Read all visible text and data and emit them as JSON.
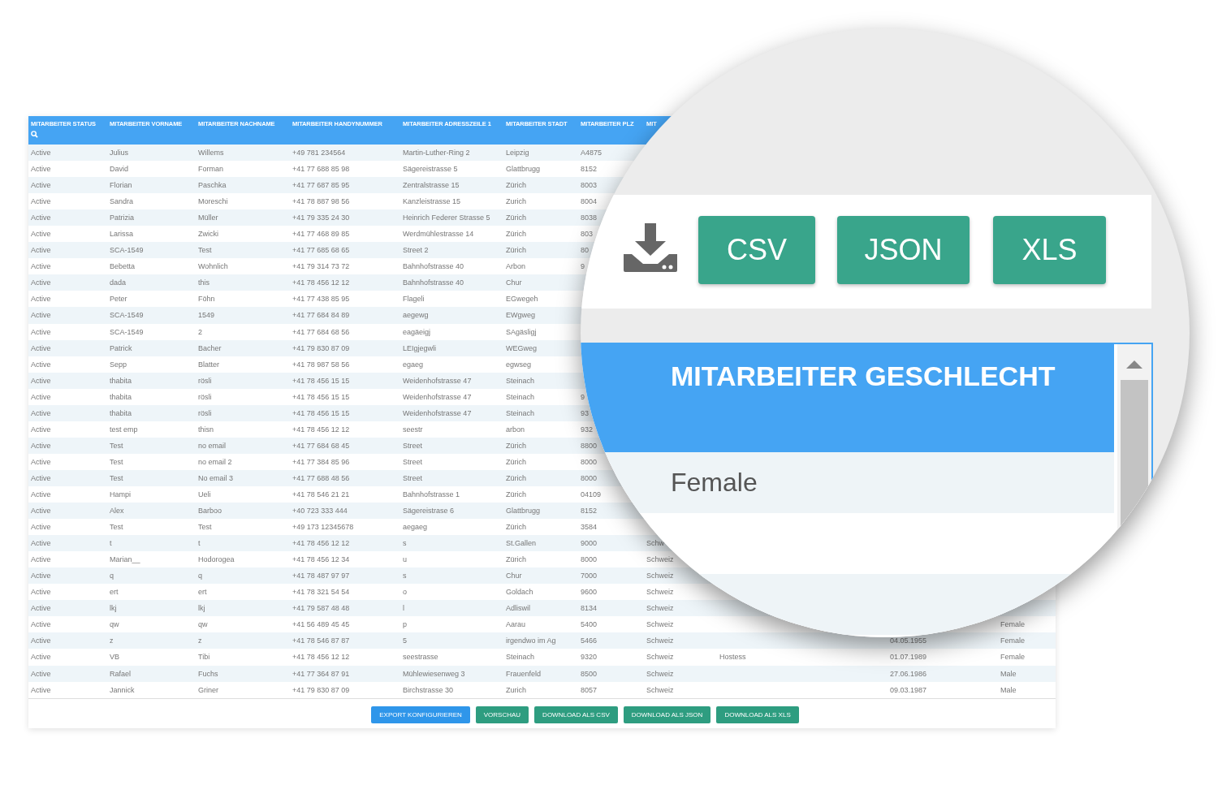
{
  "table": {
    "columns": [
      "MITARBEITER STATUS",
      "MITARBEITER VORNAME",
      "MITARBEITER NACHNAME",
      "MITARBEITER HANDYNUMMER",
      "MITARBEITER ADRESSZEILE 1",
      "MITARBEITER STADT",
      "MITARBEITER PLZ",
      "MIT",
      null,
      null,
      null
    ],
    "rows": [
      [
        "Active",
        "Julius",
        "Willems",
        "+49 781 234564",
        "Martin-Luther-Ring 2",
        "Leipzig",
        "A4875",
        null,
        null,
        null,
        null
      ],
      [
        "Active",
        "David",
        "Forman",
        "+41 77 688 85 98",
        "Sägereistrasse 5",
        "Glattbrugg",
        "8152",
        null,
        null,
        null,
        null
      ],
      [
        "Active",
        "Florian",
        "Paschka",
        "+41 77 687 85 95",
        "Zentralstrasse 15",
        "Zürich",
        "8003",
        null,
        null,
        null,
        null
      ],
      [
        "Active",
        "Sandra",
        "Moreschi",
        "+41 78 887 98 56",
        "Kanzleistrasse 15",
        "Zurich",
        "8004",
        null,
        null,
        null,
        null
      ],
      [
        "Active",
        "Patrizia",
        "Müller",
        "+41 79 335 24 30",
        "Heinrich Federer Strasse 5",
        "Zürich",
        "8038",
        null,
        null,
        null,
        null
      ],
      [
        "Active",
        "Larissa",
        "Zwicki",
        "+41 77 468 89 85",
        "Werdmühlestrasse 14",
        "Zürich",
        "803",
        null,
        null,
        null,
        null
      ],
      [
        "Active",
        "SCA-1549",
        "Test",
        "+41 77 685 68 65",
        "Street 2",
        "Zürich",
        "80",
        null,
        null,
        null,
        null
      ],
      [
        "Active",
        "Bebetta",
        "Wohnlich",
        "+41 79 314 73 72",
        "Bahnhofstrasse 40",
        "Arbon",
        "9",
        null,
        null,
        null,
        null
      ],
      [
        "Active",
        "dada",
        "this",
        "+41 78 456 12 12",
        "Bahnhofstrasse 40",
        "Chur",
        null,
        null,
        null,
        null,
        null
      ],
      [
        "Active",
        "Peter",
        "Föhn",
        "+41 77 438 85 95",
        "Flageli",
        "EGwegeh",
        null,
        null,
        null,
        null,
        null
      ],
      [
        "Active",
        "SCA-1549",
        "1549",
        "+41 77 684 84 89",
        "aegewg",
        "EWgweg",
        null,
        null,
        null,
        null,
        null
      ],
      [
        "Active",
        "SCA-1549",
        "2",
        "+41 77 684 68 56",
        "eagäeigj",
        "SAgäsligj",
        null,
        null,
        null,
        null,
        null
      ],
      [
        "Active",
        "Patrick",
        "Bacher",
        "+41 79 830 87 09",
        "LEIgjegwli",
        "WEGweg",
        null,
        null,
        null,
        null,
        null
      ],
      [
        "Active",
        "Sepp",
        "Blatter",
        "+41 78 987 58 56",
        "egaeg",
        "egwseg",
        null,
        null,
        null,
        null,
        null
      ],
      [
        "Active",
        "thabita",
        "rösli",
        "+41 78 456 15 15",
        "Weidenhofstrasse 47",
        "Steinach",
        null,
        null,
        null,
        null,
        null
      ],
      [
        "Active",
        "thabita",
        "rösli",
        "+41 78 456 15 15",
        "Weidenhofstrasse 47",
        "Steinach",
        "9",
        null,
        null,
        null,
        null
      ],
      [
        "Active",
        "thabita",
        "rösli",
        "+41 78 456 15 15",
        "Weidenhofstrasse 47",
        "Steinach",
        "93",
        null,
        null,
        null,
        null
      ],
      [
        "Active",
        "test emp",
        "thisn",
        "+41 78 456 12 12",
        "seestr",
        "arbon",
        "932",
        null,
        null,
        null,
        null
      ],
      [
        "Active",
        "Test",
        "no email",
        "+41 77 684 68 45",
        "Street",
        "Zürich",
        "8800",
        null,
        null,
        null,
        null
      ],
      [
        "Active",
        "Test",
        "no email 2",
        "+41 77 384 85 96",
        "Street",
        "Zürich",
        "8000",
        null,
        null,
        null,
        null
      ],
      [
        "Active",
        "Test",
        "No email 3",
        "+41 77 688 48 56",
        "Street",
        "Zürich",
        "8000",
        null,
        null,
        null,
        null
      ],
      [
        "Active",
        "Hampi",
        "Ueli",
        "+41 78 546 21 21",
        "Bahnhofstrasse 1",
        "Zürich",
        "04109",
        null,
        null,
        null,
        null
      ],
      [
        "Active",
        "Alex",
        "Barboo",
        "+40 723 333 444",
        "Sägereistrase 6",
        "Glattbrugg",
        "8152",
        null,
        null,
        null,
        null
      ],
      [
        "Active",
        "Test",
        "Test",
        "+49 173 12345678",
        "aegaeg",
        "Zürich",
        "3584",
        null,
        null,
        null,
        null
      ],
      [
        "Active",
        "t",
        "t",
        "+41 78 456 12 12",
        "s",
        "St.Gallen",
        "9000",
        "Schw",
        null,
        null,
        null
      ],
      [
        "Active",
        "Marian__",
        "Hodorogea",
        "+41 78 456 12 34",
        "u",
        "Zürich",
        "8000",
        "Schweiz",
        null,
        null,
        null
      ],
      [
        "Active",
        "q",
        "q",
        "+41 78 487 97 97",
        "s",
        "Chur",
        "7000",
        "Schweiz",
        null,
        null,
        null
      ],
      [
        "Active",
        "ert",
        "ert",
        "+41 78 321 54 54",
        "o",
        "Goldach",
        "9600",
        "Schweiz",
        null,
        null,
        null
      ],
      [
        "Active",
        "lkj",
        "lkj",
        "+41 79 587 48 48",
        "l",
        "Adliswil",
        "8134",
        "Schweiz",
        null,
        null,
        null
      ],
      [
        "Active",
        "qw",
        "qw",
        "+41 56 489 45 45",
        "p",
        "Aarau",
        "5400",
        "Schweiz",
        null,
        null,
        "Female"
      ],
      [
        "Active",
        "z",
        "z",
        "+41 78 546 87 87",
        "5",
        "irgendwo im Ag",
        "5466",
        "Schweiz",
        null,
        "04.05.1955",
        "Female"
      ],
      [
        "Active",
        "VB",
        "Tibi",
        "+41 78 456 12 12",
        "seestrasse",
        "Steinach",
        "9320",
        "Schweiz",
        "Hostess",
        "01.07.1989",
        "Female"
      ],
      [
        "Active",
        "Rafael",
        "Fuchs",
        "+41 77 364 87 91",
        "Mühlewiesenweg 3",
        "Frauenfeld",
        "8500",
        "Schweiz",
        null,
        "27.06.1986",
        "Male"
      ],
      [
        "Active",
        "Jannick",
        "Griner",
        "+41 79 830 87 09",
        "Birchstrasse 30",
        "Zurich",
        "8057",
        "Schweiz",
        null,
        "09.03.1987",
        "Male"
      ]
    ]
  },
  "footer_buttons": [
    {
      "label": "EXPORT KONFIGURIEREN",
      "kind": "primary"
    },
    {
      "label": "VORSCHAU",
      "kind": "success"
    },
    {
      "label": "DOWNLOAD ALS CSV",
      "kind": "success"
    },
    {
      "label": "DOWNLOAD ALS JSON",
      "kind": "success"
    },
    {
      "label": "DOWNLOAD ALS XLS",
      "kind": "success"
    }
  ],
  "magnifier": {
    "export_buttons": [
      "CSV",
      "JSON",
      "XLS"
    ],
    "list": {
      "header": "MITARBEITER GESCHLECHT",
      "items": [
        "Female"
      ]
    }
  }
}
